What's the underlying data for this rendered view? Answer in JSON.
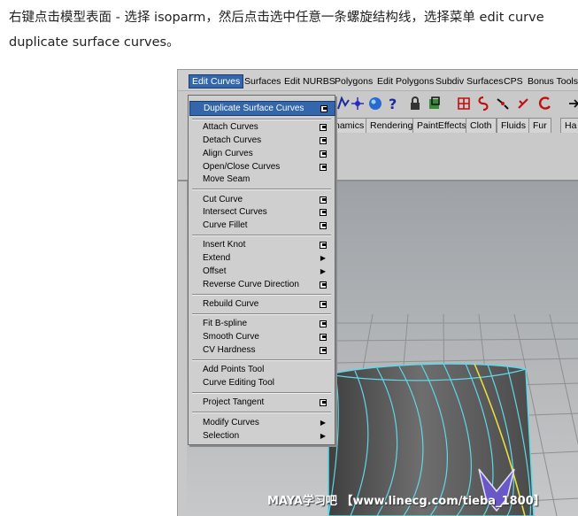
{
  "intro": {
    "line1": "右键点击模型表面 - 选择 isoparm，然后点击选中任意一条螺旋结构线，选择菜单 edit curve",
    "line2": "duplicate surface curves。"
  },
  "menubar": {
    "items": [
      "Edit Curves",
      "Surfaces",
      "Edit NURBS",
      "Polygons",
      "Edit Polygons",
      "Subdiv Surfaces",
      "CPS",
      "Bonus Tools"
    ]
  },
  "shelf_tabs": [
    "namics",
    "Rendering",
    "PaintEffects",
    "Cloth",
    "Fluids",
    "Fur",
    "Ha"
  ],
  "menu": {
    "items": [
      {
        "label": "Duplicate Surface Curves",
        "options": true,
        "highlighted": true
      },
      {
        "label": "Attach Curves",
        "options": true
      },
      {
        "label": "Detach Curves",
        "options": true
      },
      {
        "label": "Align Curves",
        "options": true
      },
      {
        "label": "Open/Close Curves",
        "options": true
      },
      {
        "label": "Move Seam",
        "options": false
      },
      {
        "label": "Cut Curve",
        "options": true
      },
      {
        "label": "Intersect Curves",
        "options": true
      },
      {
        "label": "Curve Fillet",
        "options": true
      },
      {
        "label": "Insert Knot",
        "options": true
      },
      {
        "label": "Extend",
        "submenu": true
      },
      {
        "label": "Offset",
        "submenu": true
      },
      {
        "label": "Reverse Curve Direction",
        "options": true
      },
      {
        "label": "Rebuild Curve",
        "options": true
      },
      {
        "label": "Fit B-spline",
        "options": true
      },
      {
        "label": "Smooth Curve",
        "options": true
      },
      {
        "label": "CV Hardness",
        "options": true
      },
      {
        "label": "Add Points Tool",
        "options": false
      },
      {
        "label": "Curve Editing Tool",
        "options": false
      },
      {
        "label": "Project Tangent",
        "options": true
      },
      {
        "label": "Modify Curves",
        "submenu": true
      },
      {
        "label": "Selection",
        "submenu": true
      }
    ],
    "submenu_arrow": "▶"
  },
  "watermark": "MAYA学习吧 【www.linecg.com/tieba_1800】",
  "colors": {
    "menu_highlight": "#3366aa",
    "wire": "#5fd8e8",
    "selected_curve": "#e8e040",
    "surface": "#5a5a5a"
  }
}
